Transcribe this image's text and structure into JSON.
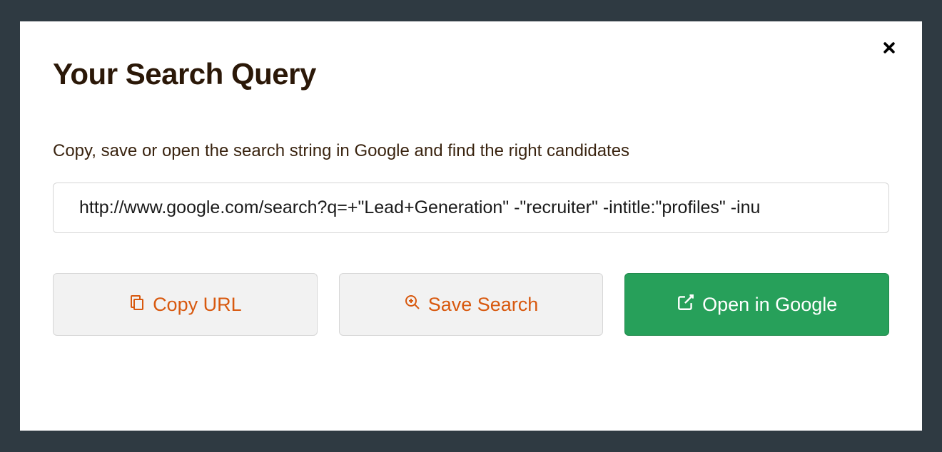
{
  "modal": {
    "title": "Your Search Query",
    "subtitle": "Copy, save or open the search string in Google and find the right candidates",
    "url_value": "http://www.google.com/search?q=+\"Lead+Generation\" -\"recruiter\" -intitle:\"profiles\" -inu",
    "buttons": {
      "copy": "Copy URL",
      "save": "Save Search",
      "open": "Open in Google"
    }
  }
}
